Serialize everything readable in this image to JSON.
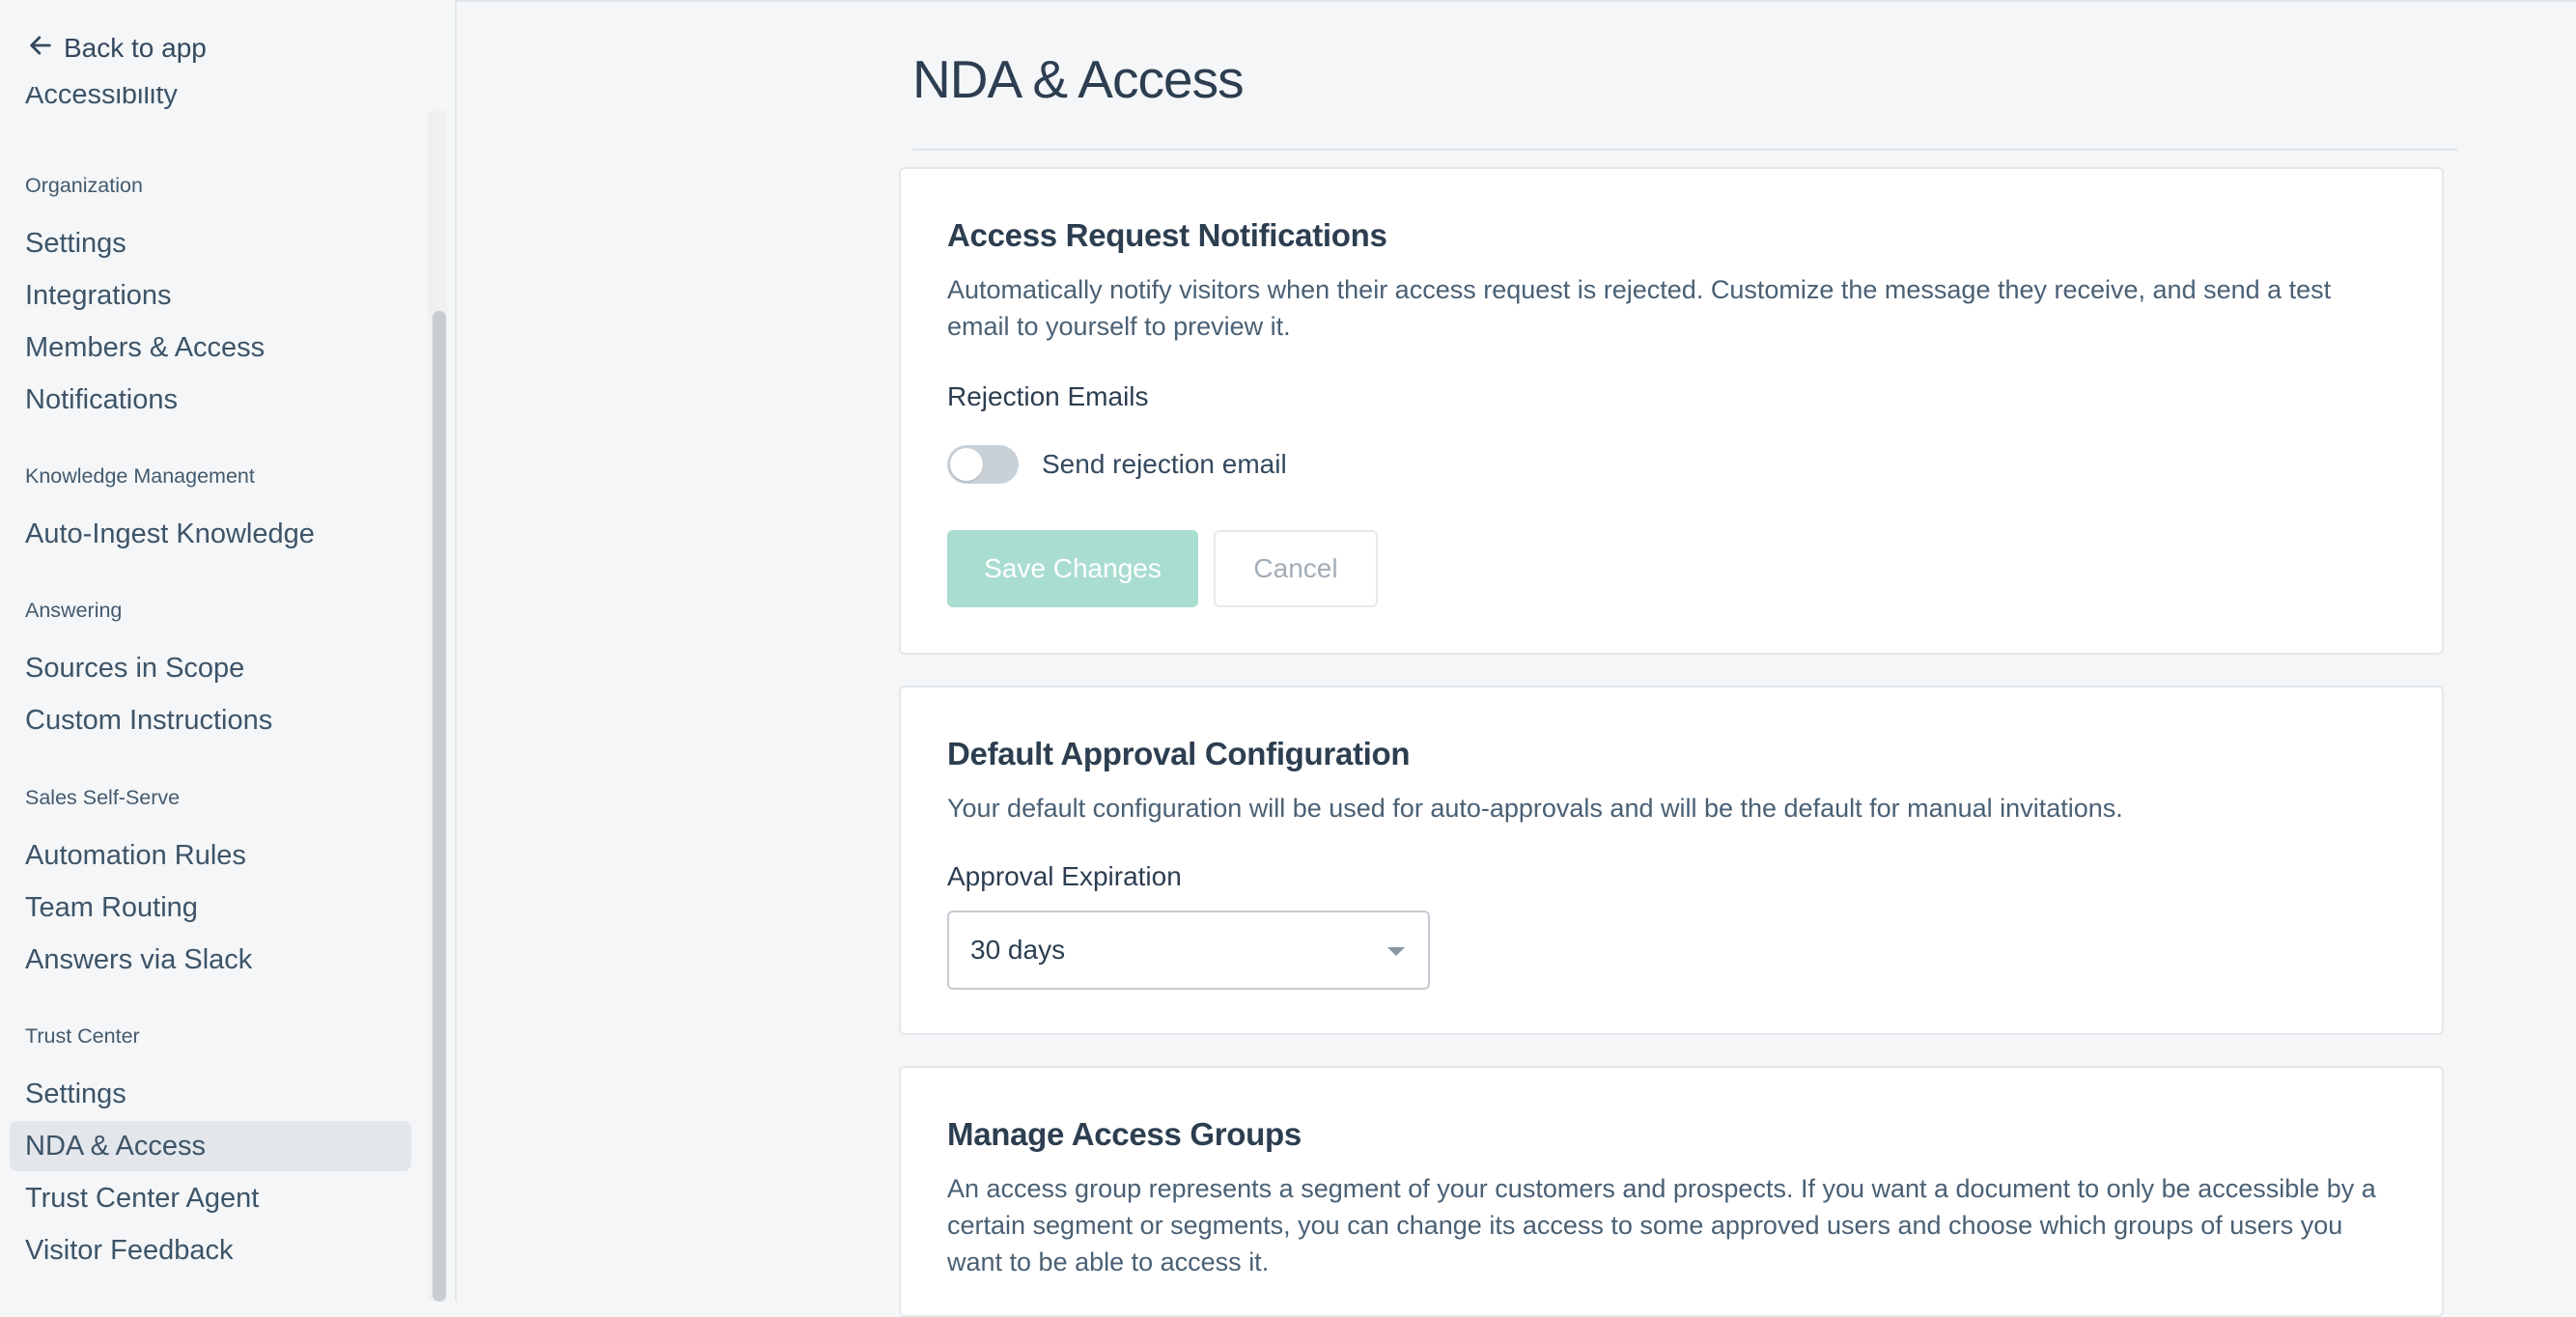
{
  "sidebar": {
    "back_label": "Back to app",
    "cut_item": "Accessibility",
    "sections": {
      "organization": "Organization",
      "knowledge": "Knowledge Management",
      "answering": "Answering",
      "sales": "Sales Self-Serve",
      "trust": "Trust Center"
    },
    "items": {
      "org_settings": "Settings",
      "integrations": "Integrations",
      "members": "Members & Access",
      "notifications": "Notifications",
      "auto_ingest": "Auto-Ingest Knowledge",
      "sources": "Sources in Scope",
      "custom_instructions": "Custom Instructions",
      "automation_rules": "Automation Rules",
      "team_routing": "Team Routing",
      "answers_slack": "Answers via Slack",
      "tc_settings": "Settings",
      "nda_access": "NDA & Access",
      "tc_agent": "Trust Center Agent",
      "visitor_feedback": "Visitor Feedback"
    }
  },
  "main": {
    "page_title": "NDA & Access",
    "access_card": {
      "title": "Access Request Notifications",
      "description": "Automatically notify visitors when their access request is rejected. Customize the message they receive, and send a test email to yourself to preview it.",
      "field_label": "Rejection Emails",
      "toggle_label": "Send rejection email",
      "toggle_on": false,
      "save_label": "Save Changes",
      "cancel_label": "Cancel"
    },
    "approval_card": {
      "title": "Default Approval Configuration",
      "description": "Your default configuration will be used for auto-approvals and will be the default for manual invitations.",
      "field_label": "Approval Expiration",
      "select_value": "30 days"
    },
    "groups_card": {
      "title": "Manage Access Groups",
      "description": "An access group represents a segment of your customers and prospects. If you want a document to only be accessible by a certain segment or segments, you can change its access to some approved users and choose which groups of users you want to be able to access it."
    }
  },
  "colors": {
    "accent_disabled": "#a9ddd0",
    "active_nav_bg": "#e3e6ea",
    "text_primary": "#2c3e50"
  }
}
